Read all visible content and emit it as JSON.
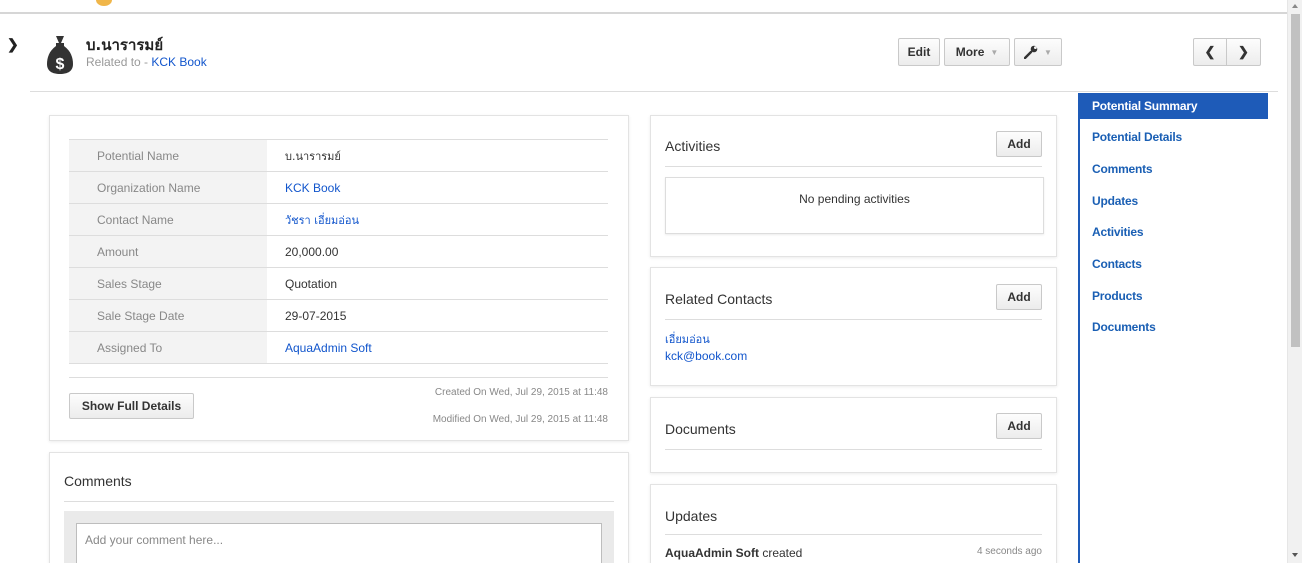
{
  "header": {
    "title": "บ.นารารมย์",
    "related_prefix": "Related to - ",
    "related_link": "KCK Book"
  },
  "toolbar": {
    "edit_label": "Edit",
    "more_label": "More"
  },
  "summary": {
    "rows": [
      {
        "label": "Potential Name",
        "value": "บ.นารารมย์"
      },
      {
        "label": "Organization Name",
        "value": "KCK Book"
      },
      {
        "label": "Contact Name",
        "value": "วัชรา เอี่ยมอ่อน"
      },
      {
        "label": "Amount",
        "value": "20,000.00"
      },
      {
        "label": "Sales Stage",
        "value": "Quotation"
      },
      {
        "label": "Sale Stage Date",
        "value": "29-07-2015"
      },
      {
        "label": "Assigned To",
        "value": "AquaAdmin Soft"
      }
    ],
    "show_full_label": "Show Full Details",
    "created_on": "Created On Wed, Jul 29, 2015 at 11:48",
    "modified_on": "Modified On Wed, Jul 29, 2015 at 11:48"
  },
  "comments": {
    "title": "Comments",
    "placeholder": "Add your comment here..."
  },
  "activities": {
    "title": "Activities",
    "add_label": "Add",
    "empty_text": "No pending activities"
  },
  "related_contacts": {
    "title": "Related Contacts",
    "add_label": "Add",
    "contact_name": "เอี่ยมอ่อน",
    "contact_email": "kck@book.com"
  },
  "documents": {
    "title": "Documents",
    "add_label": "Add"
  },
  "updates": {
    "title": "Updates",
    "actor": "AquaAdmin Soft",
    "action": " created",
    "time": "4 seconds ago"
  },
  "sidenav": {
    "items": [
      "Potential Summary",
      "Potential Details",
      "Comments",
      "Updates",
      "Activities",
      "Contacts",
      "Products",
      "Documents"
    ]
  },
  "colors": {
    "accent": "#1e5bb8",
    "link": "#1155cc"
  }
}
